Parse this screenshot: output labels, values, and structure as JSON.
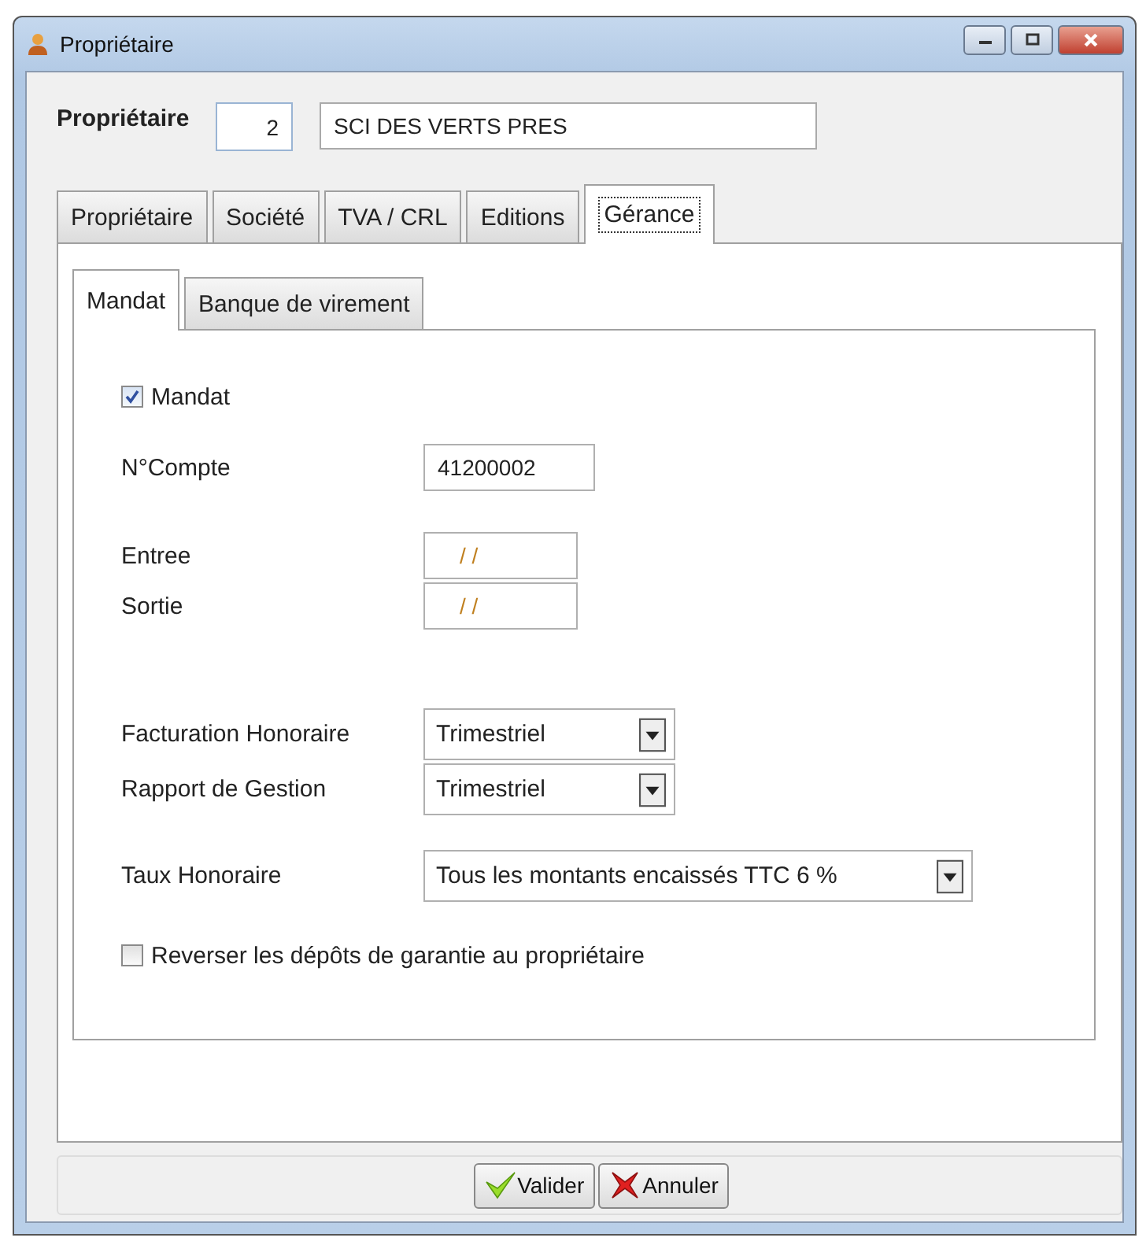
{
  "window": {
    "title": "Propriétaire"
  },
  "header": {
    "label": "Propriétaire",
    "number": "2",
    "name": "SCI DES VERTS PRES"
  },
  "tabs": [
    {
      "label": "Propriétaire",
      "selected": false
    },
    {
      "label": "Société",
      "selected": false
    },
    {
      "label": "TVA / CRL",
      "selected": false
    },
    {
      "label": "Editions",
      "selected": false
    },
    {
      "label": "Gérance",
      "selected": true
    }
  ],
  "subtabs": [
    {
      "label": "Mandat",
      "selected": true
    },
    {
      "label": "Banque de virement",
      "selected": false
    }
  ],
  "groups": [
    [
      {
        "kind": "checkbox",
        "label": "Mandat",
        "checked": true
      }
    ],
    [
      {
        "kind": "text",
        "label": "N°Compte",
        "value": "41200002"
      }
    ],
    [
      {
        "kind": "date",
        "label": "Entree",
        "value": "/ /"
      },
      {
        "kind": "date",
        "label": "Sortie",
        "value": "/ /"
      }
    ],
    [
      {
        "kind": "combo",
        "label": "Facturation Honoraire",
        "value": "Trimestriel"
      },
      {
        "kind": "combo",
        "label": "Rapport de Gestion",
        "value": "Trimestriel"
      }
    ],
    [
      {
        "kind": "wide-combo",
        "label": "Taux Honoraire",
        "value": "Tous les montants encaissés TTC 6 %"
      }
    ],
    [
      {
        "kind": "checkbox",
        "label": "Reverser les dépôts de garantie au propriétaire",
        "checked": false
      }
    ]
  ],
  "buttons": [
    {
      "kind": "ok",
      "label": "Valider"
    },
    {
      "kind": "cancel",
      "label": "Annuler"
    }
  ]
}
